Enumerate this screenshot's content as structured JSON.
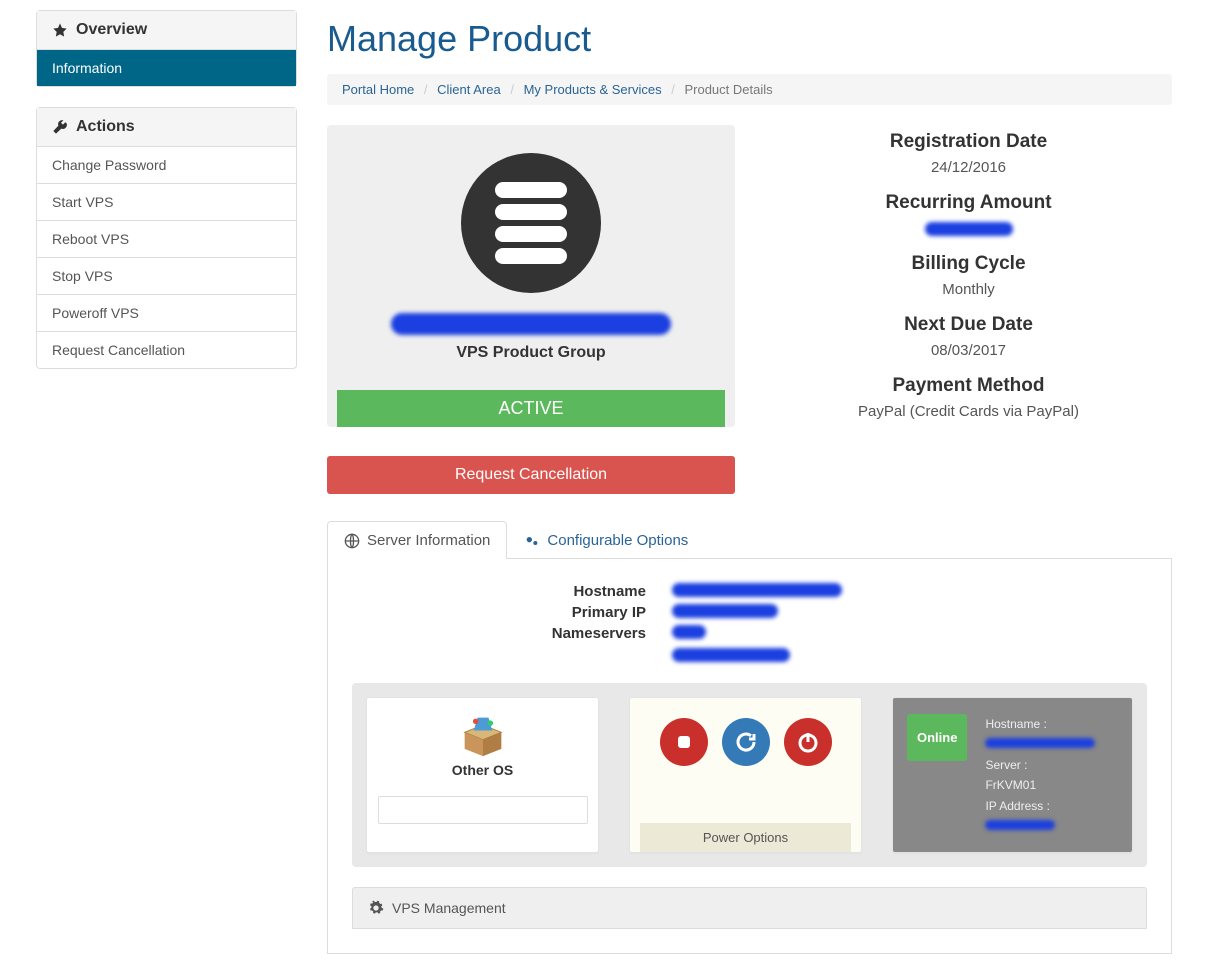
{
  "page_title": "Manage Product",
  "breadcrumb": {
    "home": "Portal Home",
    "client": "Client Area",
    "products": "My Products & Services",
    "current": "Product Details"
  },
  "sidebar": {
    "overview": {
      "title": "Overview",
      "information": "Information"
    },
    "actions": {
      "title": "Actions",
      "items": [
        "Change Password",
        "Start VPS",
        "Reboot VPS",
        "Stop VPS",
        "Poweroff VPS",
        "Request Cancellation"
      ]
    }
  },
  "product": {
    "name_redacted": true,
    "group": "VPS Product Group",
    "status": "ACTIVE",
    "cancel_button": "Request Cancellation"
  },
  "billing": {
    "reg_date_label": "Registration Date",
    "reg_date": "24/12/2016",
    "recurring_label": "Recurring Amount",
    "recurring_redacted": true,
    "cycle_label": "Billing Cycle",
    "cycle": "Monthly",
    "due_label": "Next Due Date",
    "due": "08/03/2017",
    "method_label": "Payment Method",
    "method": "PayPal (Credit Cards via PayPal)"
  },
  "tabs": {
    "server_info": "Server Information",
    "config_options": "Configurable Options"
  },
  "server_info": {
    "hostname_k": "Hostname",
    "primary_ip_k": "Primary IP",
    "nameservers_k": "Nameservers"
  },
  "cards": {
    "other_os": "Other OS",
    "power_options": "Power Options",
    "online": "Online",
    "hostname_label": "Hostname :",
    "server_label": "Server :",
    "server_value": "FrKVM01",
    "ip_label": "IP Address :"
  },
  "vps_mgmt": "VPS Management"
}
